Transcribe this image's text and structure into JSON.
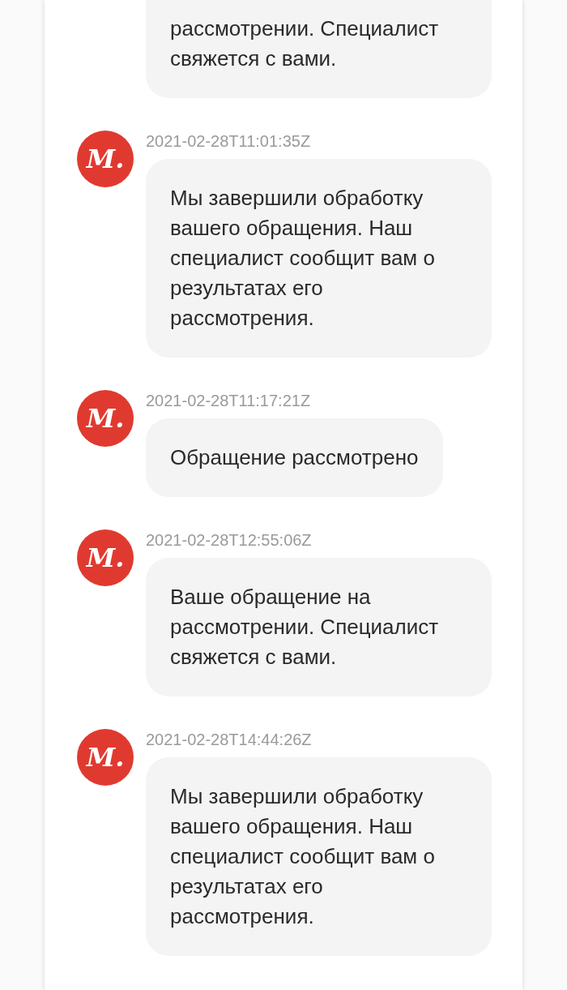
{
  "messages": [
    {
      "text": "рассмотрении. Специалист свяжется с вами.",
      "cut_top": true
    },
    {
      "avatar": "М.",
      "timestamp": "2021-02-28T11:01:35Z",
      "text": "Мы завершили обработку вашего обращения. Наш специалист сообщит вам о результатах его рассмотрения.",
      "cut_top": false
    },
    {
      "avatar": "М.",
      "timestamp": "2021-02-28T11:17:21Z",
      "text": "Обращение рассмотрено",
      "cut_top": false
    },
    {
      "avatar": "М.",
      "timestamp": "2021-02-28T12:55:06Z",
      "text": "Ваше обращение на рассмотрении. Специалист свяжется с вами.",
      "cut_top": false
    },
    {
      "avatar": "М.",
      "timestamp": "2021-02-28T14:44:26Z",
      "text": "Мы завершили обработку вашего обращения. Наш специалист сообщит вам о результатах его рассмотрения.",
      "cut_top": false
    }
  ]
}
